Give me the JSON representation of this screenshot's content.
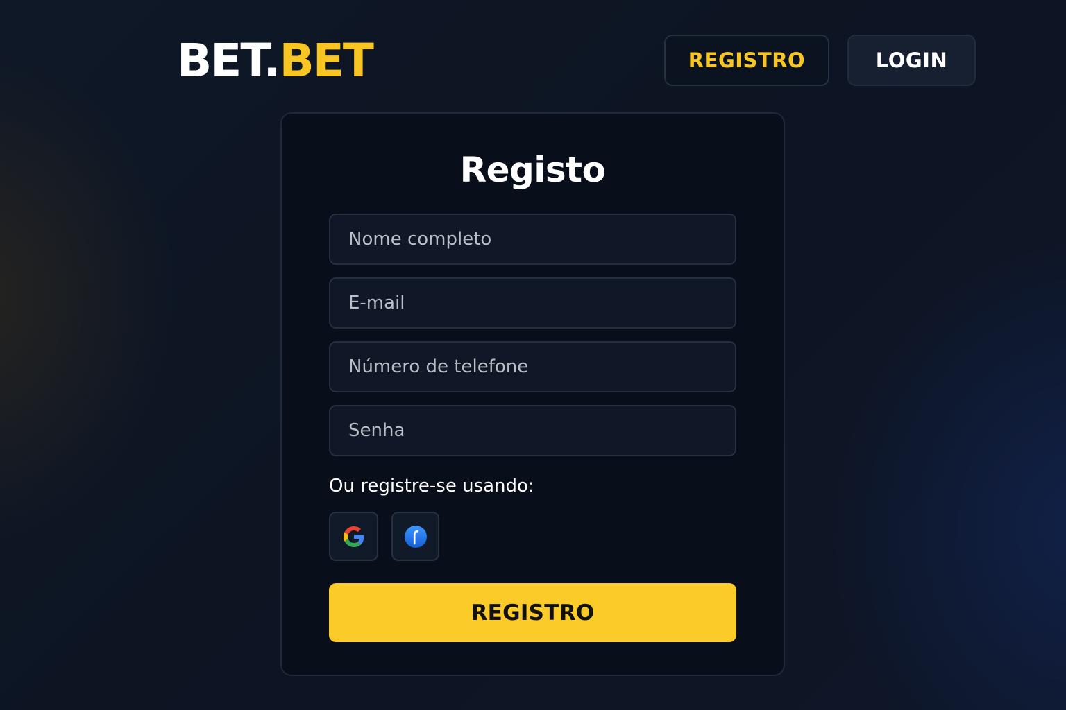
{
  "header": {
    "logo": {
      "part1": "BET.",
      "part2": "BET"
    },
    "register_label": "REGISTRO",
    "login_label": "LOGIN"
  },
  "form": {
    "title": "Registo",
    "fields": {
      "full_name": {
        "placeholder": "Nome completo",
        "value": ""
      },
      "email": {
        "placeholder": "E-mail",
        "value": ""
      },
      "phone": {
        "placeholder": "Número de telefone",
        "value": ""
      },
      "password": {
        "placeholder": "Senha",
        "value": ""
      }
    },
    "social_label": "Ou registre-se usando:",
    "social_providers": [
      {
        "name": "google",
        "icon": "google-icon"
      },
      {
        "name": "facebook",
        "icon": "facebook-icon"
      }
    ],
    "submit_label": "REGISTRO"
  },
  "colors": {
    "accent": "#f8c523",
    "background": "#0d1523",
    "card": "#080e1a"
  }
}
